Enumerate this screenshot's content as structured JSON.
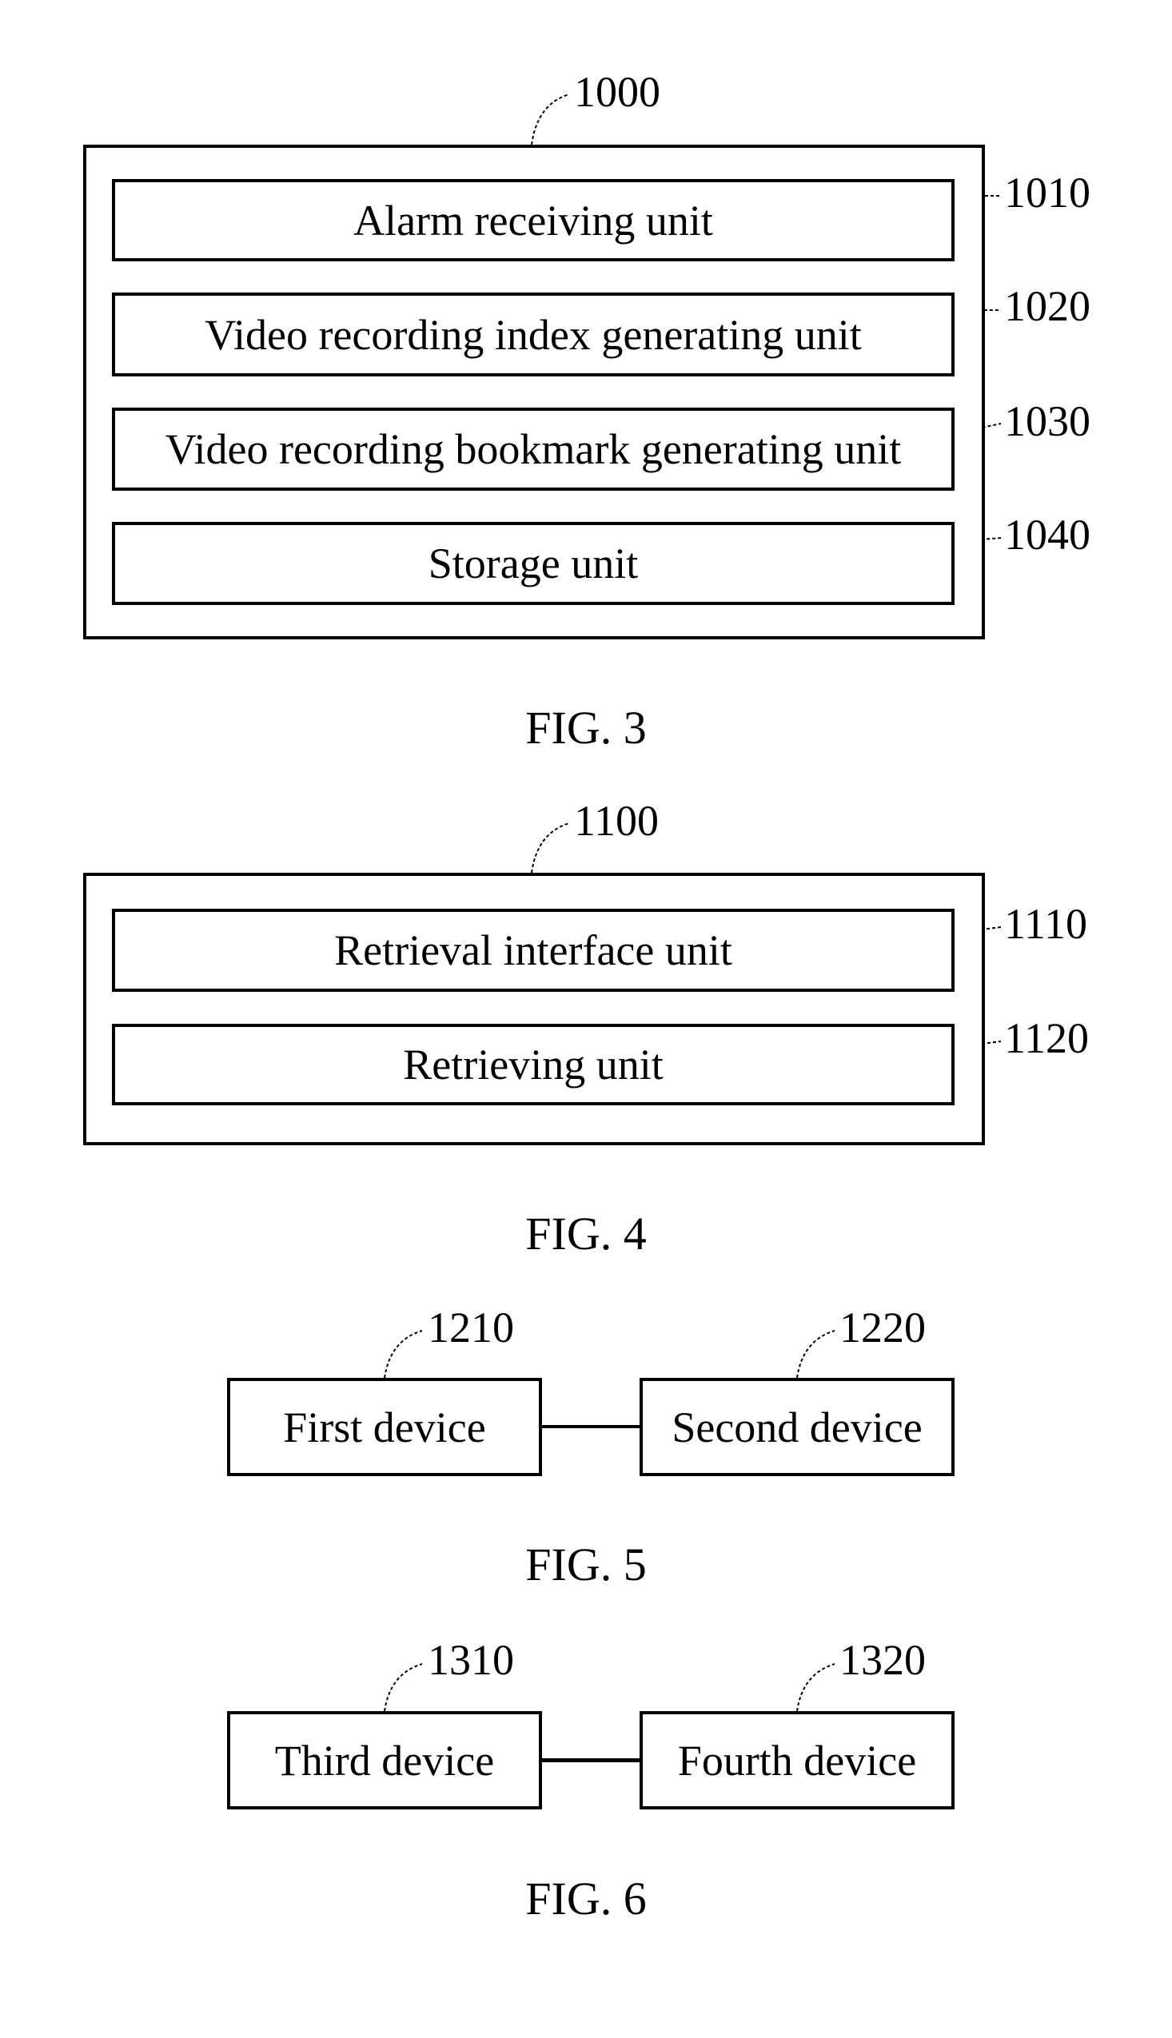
{
  "figures": {
    "fig3": {
      "caption": "FIG. 3",
      "container_ref": "1000",
      "units": [
        {
          "label": "Alarm receiving unit",
          "ref": "1010"
        },
        {
          "label": "Video recording index generating unit",
          "ref": "1020"
        },
        {
          "label": "Video recording bookmark generating unit",
          "ref": "1030"
        },
        {
          "label": "Storage unit",
          "ref": "1040"
        }
      ]
    },
    "fig4": {
      "caption": "FIG. 4",
      "container_ref": "1100",
      "units": [
        {
          "label": "Retrieval interface unit",
          "ref": "1110"
        },
        {
          "label": "Retrieving unit",
          "ref": "1120"
        }
      ]
    },
    "fig5": {
      "caption": "FIG. 5",
      "devices": [
        {
          "label": "First device",
          "ref": "1210"
        },
        {
          "label": "Second device",
          "ref": "1220"
        }
      ]
    },
    "fig6": {
      "caption": "FIG. 6",
      "devices": [
        {
          "label": "Third device",
          "ref": "1310"
        },
        {
          "label": "Fourth device",
          "ref": "1320"
        }
      ]
    }
  }
}
